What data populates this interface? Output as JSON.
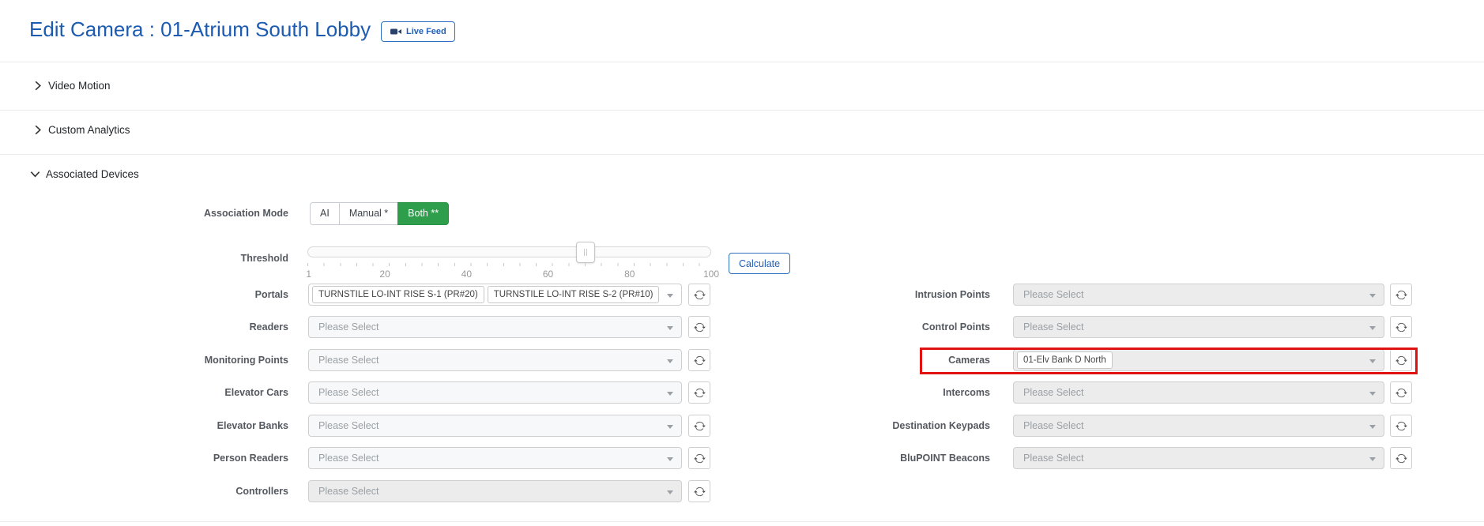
{
  "colors": {
    "accent_blue": "#1d5bb0",
    "success_green": "#2e9e4c",
    "highlight_red": "#e01212"
  },
  "header": {
    "title": "Edit Camera : 01-Atrium South Lobby",
    "live_feed_label": "Live Feed"
  },
  "sections": [
    {
      "label": "Video Motion",
      "state": "collapsed"
    },
    {
      "label": "Custom Analytics",
      "state": "collapsed"
    },
    {
      "label": "Associated Devices",
      "state": "expanded"
    }
  ],
  "association_mode": {
    "label": "Association Mode",
    "options": [
      "AI",
      "Manual *",
      "Both **"
    ],
    "selected": "Both **"
  },
  "threshold": {
    "label": "Threshold",
    "min": 1,
    "max": 100,
    "value": 69,
    "tick_labels": [
      "1",
      "20",
      "40",
      "60",
      "80",
      "100"
    ],
    "calculate_label": "Calculate"
  },
  "fields": {
    "left": [
      {
        "label": "Portals",
        "tags": [
          "TURNSTILE LO-INT RISE S-1 (PR#20)",
          "TURNSTILE LO-INT RISE S-2 (PR#10)"
        ]
      },
      {
        "label": "Readers",
        "placeholder": "Please Select"
      },
      {
        "label": "Monitoring Points",
        "placeholder": "Please Select"
      },
      {
        "label": "Elevator Cars",
        "placeholder": "Please Select"
      },
      {
        "label": "Elevator Banks",
        "placeholder": "Please Select"
      },
      {
        "label": "Person Readers",
        "placeholder": "Please Select"
      },
      {
        "label": "Controllers",
        "placeholder": "Please Select"
      }
    ],
    "right": [
      {
        "label": "Intrusion Points",
        "placeholder": "Please Select"
      },
      {
        "label": "Control Points",
        "placeholder": "Please Select"
      },
      {
        "label": "Cameras",
        "tags": [
          "01-Elv Bank D North"
        ],
        "highlighted": true
      },
      {
        "label": "Intercoms",
        "placeholder": "Please Select"
      },
      {
        "label": "Destination Keypads",
        "placeholder": "Please Select"
      },
      {
        "label": "BluPOINT Beacons",
        "placeholder": "Please Select"
      }
    ]
  }
}
